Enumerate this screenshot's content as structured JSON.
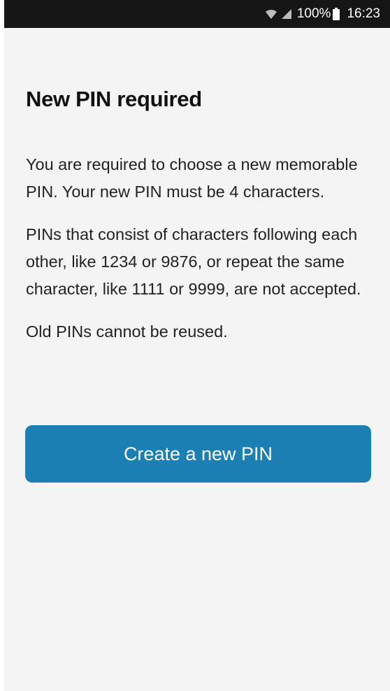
{
  "status_bar": {
    "battery": "100%",
    "time": "16:23",
    "icons": [
      "wifi-icon",
      "signal-icon",
      "battery-icon"
    ]
  },
  "screen": {
    "title": "New PIN required",
    "paragraphs": [
      "You are required to choose a new memorable PIN. Your new PIN must be 4 characters.",
      "PINs that consist of characters following each other, like 1234 or 9876, or repeat the same character, like 1111 or 9999, are not accepted.",
      "Old PINs cannot be reused."
    ],
    "button_label": "Create a new PIN"
  },
  "colors": {
    "status_bar_bg": "#161616",
    "background": "#f4f4f4",
    "button": "#1b7fb4",
    "button_text": "#ffffff",
    "text": "#222222"
  }
}
